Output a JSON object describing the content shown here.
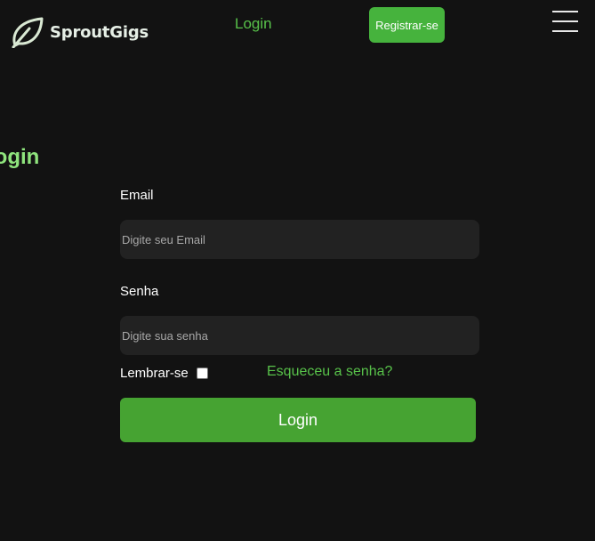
{
  "header": {
    "logo_text": "SproutGigs",
    "login_link": "Login",
    "register_button": "Registrar-se",
    "menu_icon": "hamburger-menu-icon",
    "logo_icon": "leaf-logo-icon"
  },
  "main": {
    "title": "Login",
    "email_label": "Email",
    "email_placeholder": "Digite seu Email",
    "password_label": "Senha",
    "password_placeholder": "Digite sua senha",
    "remember_label": "Lembrar-se",
    "remember_checked": false,
    "forgot_link": "Esqueceu a senha?",
    "submit_label": "Login"
  },
  "colors": {
    "background": "#121212",
    "accent": "#46b33d",
    "link": "#58c24a",
    "title": "#8fe47d",
    "field_bg": "#222222"
  }
}
